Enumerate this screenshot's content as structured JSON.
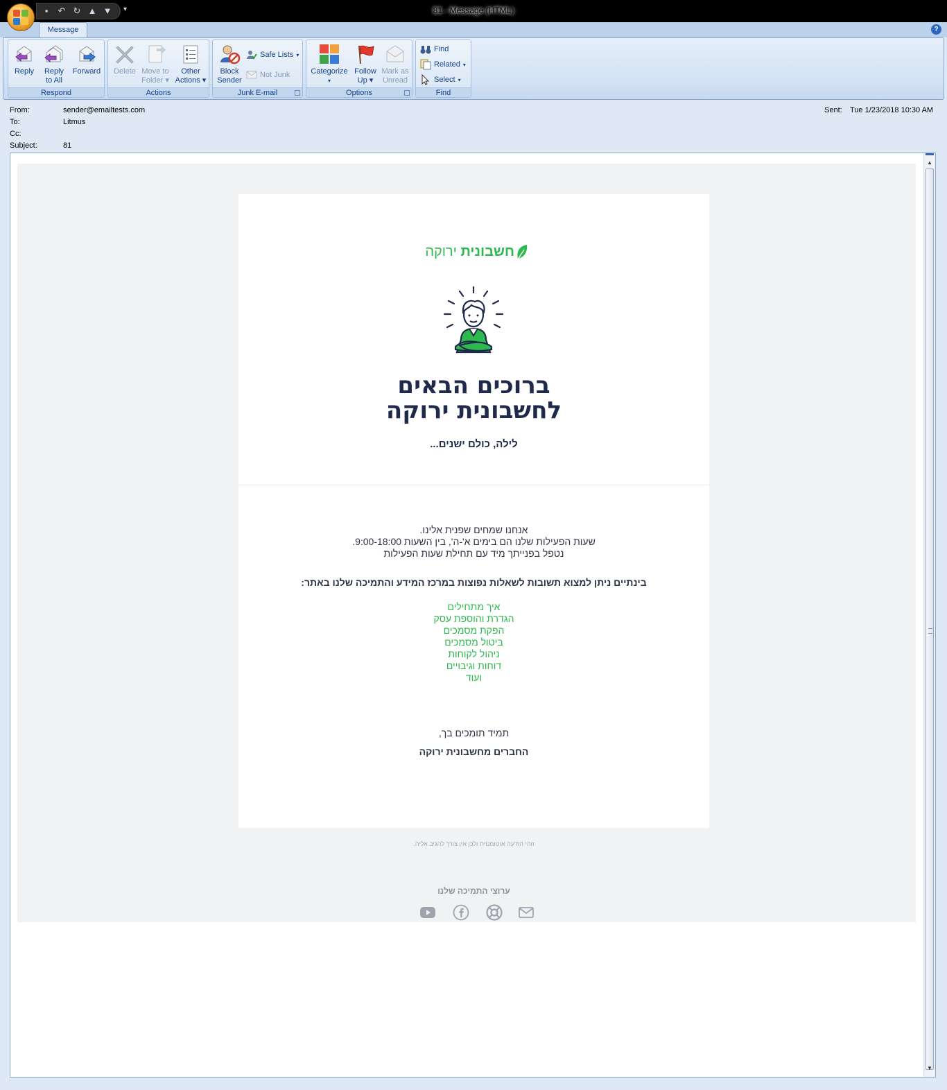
{
  "window": {
    "title": "81 - Message (HTML)",
    "tab": "Message",
    "help": "?"
  },
  "ribbon": {
    "respond": {
      "label": "Respond",
      "reply": "Reply",
      "reply_all_1": "Reply",
      "reply_all_2": "to All",
      "forward": "Forward"
    },
    "actions": {
      "label": "Actions",
      "delete": "Delete",
      "move_1": "Move to",
      "move_2": "Folder",
      "other_1": "Other",
      "other_2": "Actions"
    },
    "junk": {
      "label": "Junk E-mail",
      "block_1": "Block",
      "block_2": "Sender",
      "safe_lists": "Safe Lists",
      "not_junk": "Not Junk"
    },
    "options": {
      "label": "Options",
      "categorize": "Categorize",
      "follow_1": "Follow",
      "follow_2": "Up",
      "mark_1": "Mark as",
      "mark_2": "Unread"
    },
    "find": {
      "label": "Find",
      "find": "Find",
      "related": "Related",
      "select": "Select"
    }
  },
  "headers": {
    "from_label": "From:",
    "from": "sender@emailtests.com",
    "to_label": "To:",
    "to": "Litmus",
    "cc_label": "Cc:",
    "cc": "",
    "subject_label": "Subject:",
    "subject": "81",
    "sent_label": "Sent:",
    "sent": "Tue 1/23/2018 10:30 AM"
  },
  "email": {
    "logo_bold": "חשבונית",
    "logo_light": "ירוקה",
    "title_line1": "ברוכים הבאים",
    "title_line2": "לחשבונית ירוקה",
    "subtitle": "לילה, כולם ישנים...",
    "para_line1": "אנחנו שמחים שפנית אלינו.",
    "para_line2": "שעות הפעילות שלנו הם בימים א'-ה', בין השעות 9:00-18:00.",
    "para_line3": "נטפל בפנייתך מיד עם תחילת שעות הפעילות",
    "links_intro": "בינתיים ניתן למצוא תשובות לשאלות נפוצות במרכז המידע והתמיכה שלנו באתר:",
    "links": [
      "איך מתחילים",
      "הגדרת והוספת עסק",
      "הפקת מסמכים",
      "ביטול מסמכים",
      "ניהול לקוחות",
      "דוחות וגיבויים",
      "ועוד"
    ],
    "signoff": "תמיד תומכים בך,",
    "signature": "החברים מחשבונית ירוקה",
    "footnote": "זוהי הודעה אוטומטית ולכן אין צורך להגיב אליה.",
    "support_title": "ערוצי התמיכה שלנו"
  },
  "colors": {
    "brand_green": "#2db94d",
    "title_navy": "#1f2a4a"
  }
}
